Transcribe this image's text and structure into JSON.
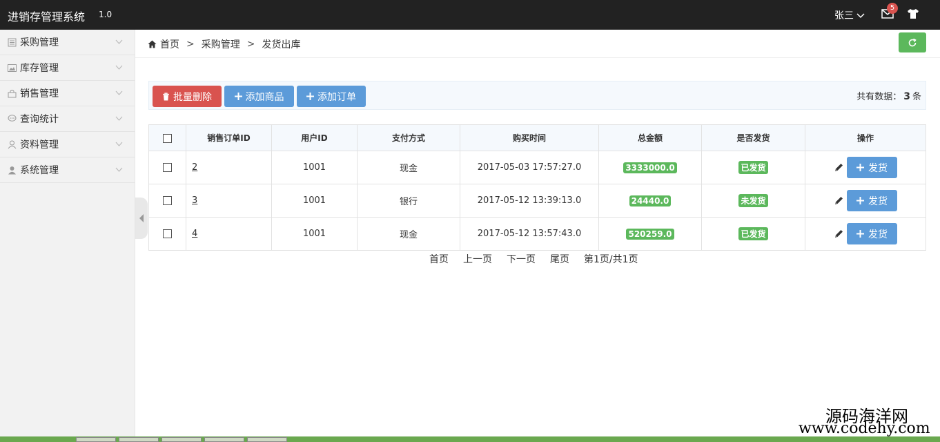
{
  "app": {
    "title": "进销存管理系统",
    "version": "1.0"
  },
  "header": {
    "user": "张三",
    "mail_count": "5"
  },
  "sidebar": {
    "items": [
      {
        "label": "采购管理",
        "icon": "list-icon"
      },
      {
        "label": "库存管理",
        "icon": "image-icon"
      },
      {
        "label": "销售管理",
        "icon": "bag-icon"
      },
      {
        "label": "查询统计",
        "icon": "comment-icon"
      },
      {
        "label": "资料管理",
        "icon": "user-icon"
      },
      {
        "label": "系统管理",
        "icon": "user-solid-icon"
      }
    ]
  },
  "breadcrumb": {
    "home": "首页",
    "sep": ">",
    "level1": "采购管理",
    "level2": "发货出库"
  },
  "toolbar": {
    "batch_delete": "批量删除",
    "add_product": "添加商品",
    "add_order": "添加订单",
    "count_prefix": "共有数据：",
    "count_value": "3",
    "count_suffix": "条"
  },
  "table": {
    "headers": [
      "销售订单ID",
      "用户ID",
      "支付方式",
      "购买时间",
      "总金额",
      "是否发货",
      "操作"
    ],
    "rows": [
      {
        "id": "2",
        "user_id": "1001",
        "payment": "现金",
        "time": "2017-05-03 17:57:27.0",
        "amount": "3333000.0",
        "shipped": "已发货",
        "action": "发货"
      },
      {
        "id": "3",
        "user_id": "1001",
        "payment": "银行",
        "time": "2017-05-12 13:39:13.0",
        "amount": "24440.0",
        "shipped": "未发货",
        "action": "发货"
      },
      {
        "id": "4",
        "user_id": "1001",
        "payment": "现金",
        "time": "2017-05-12 13:57:43.0",
        "amount": "520259.0",
        "shipped": "已发货",
        "action": "发货"
      }
    ]
  },
  "pager": {
    "first": "首页",
    "prev": "上一页",
    "next": "下一页",
    "last": "尾页",
    "info": "第1页/共1页"
  },
  "watermark": {
    "line1": "源码海洋网",
    "line2": "www.codehy.com"
  },
  "colors": {
    "topbar": "#222222",
    "success": "#5cb85c",
    "danger": "#d9534f",
    "primary": "#5c9bd9"
  }
}
